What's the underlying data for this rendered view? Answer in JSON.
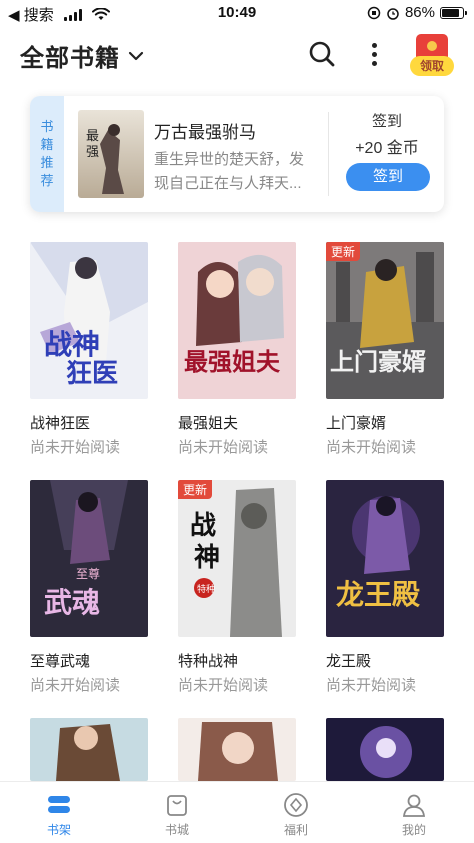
{
  "status_bar": {
    "back_label": "◀ 搜索",
    "time": "10:49",
    "battery_text": "86%",
    "battery_level": 0.86
  },
  "header": {
    "title": "全部书籍",
    "claim_label": "领取"
  },
  "recommend": {
    "tag": "书籍推荐",
    "book_title": "万古最强驸马",
    "description": "重生异世的楚天舒，发现自己正在与人拜天...",
    "checkin_text": "签到",
    "checkin_reward": "+20 金币",
    "checkin_button": "签到"
  },
  "books": [
    {
      "title": "战神狂医",
      "status": "尚未开始阅读",
      "badge": ""
    },
    {
      "title": "最强姐夫",
      "status": "尚未开始阅读",
      "badge": ""
    },
    {
      "title": "上门豪婿",
      "status": "尚未开始阅读",
      "badge": "更新"
    },
    {
      "title": "至尊武魂",
      "status": "尚未开始阅读",
      "badge": ""
    },
    {
      "title": "特种战神",
      "status": "尚未开始阅读",
      "badge": "更新"
    },
    {
      "title": "龙王殿",
      "status": "尚未开始阅读",
      "badge": ""
    }
  ],
  "bottom_nav": [
    {
      "label": "书架",
      "icon": "bookshelf-icon",
      "active": true
    },
    {
      "label": "书城",
      "icon": "store-bag-icon",
      "active": false
    },
    {
      "label": "福利",
      "icon": "welfare-diamond-icon",
      "active": false
    },
    {
      "label": "我的",
      "icon": "profile-icon",
      "active": false
    }
  ],
  "colors": {
    "accent": "#3b8ff0",
    "badge_red": "#e24a3b",
    "tag_bg": "#dcecfb",
    "claim_yellow": "#ffd83d"
  }
}
